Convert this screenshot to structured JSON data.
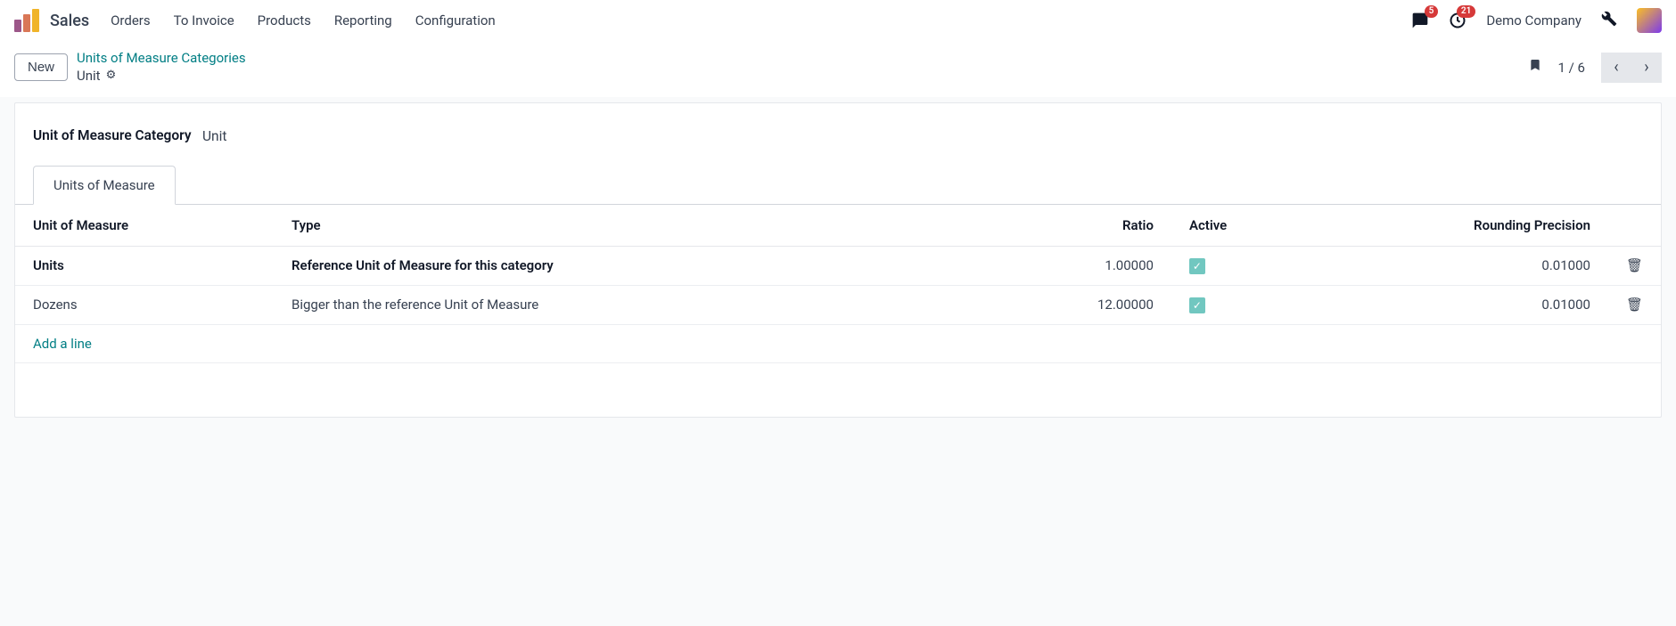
{
  "app": {
    "name": "Sales"
  },
  "nav": {
    "orders": "Orders",
    "to_invoice": "To Invoice",
    "products": "Products",
    "reporting": "Reporting",
    "configuration": "Configuration"
  },
  "header": {
    "messages_badge": "5",
    "activities_badge": "21",
    "company": "Demo Company"
  },
  "controlbar": {
    "new_label": "New",
    "breadcrumb_parent": "Units of Measure Categories",
    "breadcrumb_current": "Unit",
    "pager": "1 / 6"
  },
  "form": {
    "category_label": "Unit of Measure Category",
    "category_value": "Unit"
  },
  "tabs": {
    "uom": "Units of Measure"
  },
  "table": {
    "headers": {
      "uom": "Unit of Measure",
      "type": "Type",
      "ratio": "Ratio",
      "active": "Active",
      "rounding": "Rounding Precision"
    },
    "rows": [
      {
        "name": "Units",
        "type": "Reference Unit of Measure for this category",
        "ratio": "1.00000",
        "active": true,
        "rounding": "0.01000"
      },
      {
        "name": "Dozens",
        "type": "Bigger than the reference Unit of Measure",
        "ratio": "12.00000",
        "active": true,
        "rounding": "0.01000"
      }
    ],
    "add_line": "Add a line"
  }
}
